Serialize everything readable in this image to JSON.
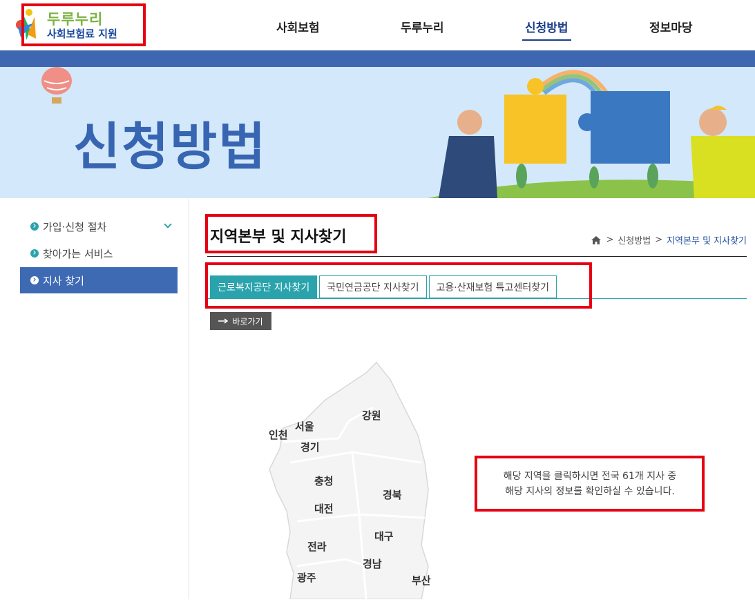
{
  "header": {
    "logo_line1": "두루누리",
    "logo_line2": "사회보험료 지원",
    "nav": [
      "사회보험",
      "두루누리",
      "신청방법",
      "정보마당"
    ]
  },
  "banner": {
    "title": "신청방법"
  },
  "sidebar": {
    "items": [
      {
        "label": "가입·신청 절차"
      },
      {
        "label": "찾아가는 서비스"
      },
      {
        "label": "지사 찾기"
      }
    ]
  },
  "content": {
    "title": "지역본부 및 지사찾기",
    "breadcrumb": [
      "신청방법",
      "지역본부 및 지사찾기"
    ],
    "tabs": [
      "근로복지공단 지사찾기",
      "국민연금공단 지사찾기",
      "고용·산재보험 특고센터찾기"
    ],
    "go_button": "바로가기",
    "info_line1": "해당 지역을 클릭하시면 전국 61개 지사 중",
    "info_line2": "해당 지사의 정보를 확인하실 수 있습니다."
  },
  "map": {
    "regions": [
      "인천",
      "서울",
      "강원",
      "경기",
      "충청",
      "경북",
      "대전",
      "대구",
      "전라",
      "경남",
      "광주",
      "부산"
    ]
  },
  "colors": {
    "brand_blue": "#3e6ab4",
    "teal": "#2aa3ad",
    "highlight_red": "#e60012"
  }
}
